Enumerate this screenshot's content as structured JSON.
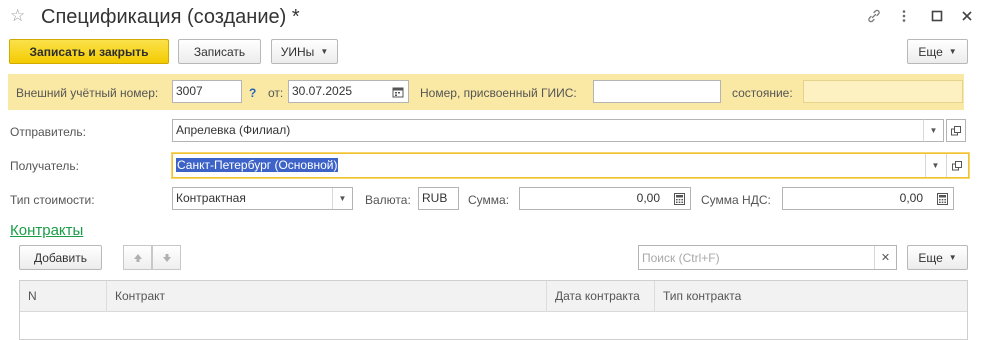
{
  "window": {
    "title": "Спецификация (создание) *",
    "icons": [
      "star-icon",
      "link-icon",
      "more-vertical-icon",
      "maximize-icon",
      "close-icon"
    ]
  },
  "toolbar": {
    "save_close": "Записать и закрыть",
    "save": "Записать",
    "uins": "УИНы",
    "more": "Еще"
  },
  "header_band": {
    "external_number_label": "Внешний учётный номер:",
    "external_number_value": "3007",
    "help": "?",
    "from_label": "от:",
    "date_value": "30.07.2025",
    "giis_label": "Номер, присвоенный ГИИС:",
    "giis_value": "",
    "state_label": "состояние:",
    "state_value": ""
  },
  "form": {
    "sender_label": "Отправитель:",
    "sender_value": "Апрелевка (Филиал)",
    "receiver_label": "Получатель:",
    "receiver_value": "Санкт-Петербург (Основной)",
    "cost_type_label": "Тип стоимости:",
    "cost_type_value": "Контрактная",
    "currency_label": "Валюта:",
    "currency_value": "RUB",
    "sum_label": "Сумма:",
    "sum_value": "0,00",
    "vat_label": "Сумма НДС:",
    "vat_value": "0,00"
  },
  "contracts": {
    "title": "Контракты",
    "add_button": "Добавить",
    "search_placeholder": "Поиск (Ctrl+F)",
    "more": "Еще",
    "columns": [
      "N",
      "Контракт",
      "Дата контракта",
      "Тип контракта"
    ]
  },
  "colors": {
    "primary_button": "#f5cf11",
    "band": "#fae9a5",
    "section_title": "#1b9d48",
    "selection": "#3d63c8"
  }
}
